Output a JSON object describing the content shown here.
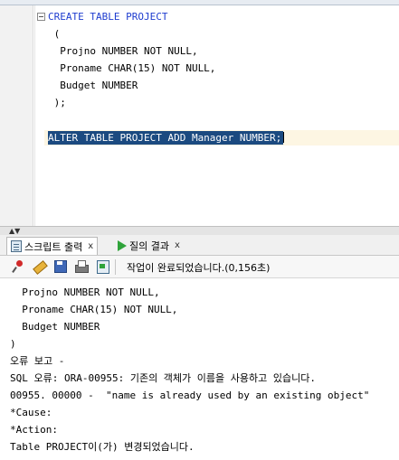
{
  "editor": {
    "lines": [
      {
        "kw": "CREATE TABLE PROJECT",
        "text": ""
      },
      {
        "kw": "",
        "text": " ("
      },
      {
        "kw": "",
        "text": "  Projno NUMBER NOT NULL,"
      },
      {
        "kw": "",
        "text": "  Proname CHAR(15) NOT NULL,"
      },
      {
        "kw": "",
        "text": "  Budget NUMBER"
      },
      {
        "kw": "",
        "text": " );"
      }
    ],
    "selected_statement": "ALTER TABLE PROJECT ADD Manager NUMBER;"
  },
  "tabs": {
    "script_output": "스크립트 출력",
    "query_result": "질의 결과",
    "close_glyph": "x"
  },
  "toolbar": {
    "icons": [
      "pin-icon",
      "eraser-icon",
      "save-icon",
      "print-icon",
      "export-icon"
    ],
    "status": "작업이 완료되었습니다.(0,156초)"
  },
  "output": {
    "lines": [
      "  Projno NUMBER NOT NULL,",
      "  Proname CHAR(15) NOT NULL,",
      "  Budget NUMBER",
      ")",
      "오류 보고 -",
      "SQL 오류: ORA-00955: 기존의 객체가 이름을 사용하고 있습니다.",
      "00955. 00000 -  \"name is already used by an existing object\"",
      "*Cause:",
      "*Action:",
      "Table PROJECT이(가) 변경되었습니다."
    ]
  },
  "colors": {
    "keyword": "#1f3dcf",
    "selection": "#1b4a80",
    "current_line": "#fdf6e3",
    "run_icon": "#2fa33a"
  }
}
